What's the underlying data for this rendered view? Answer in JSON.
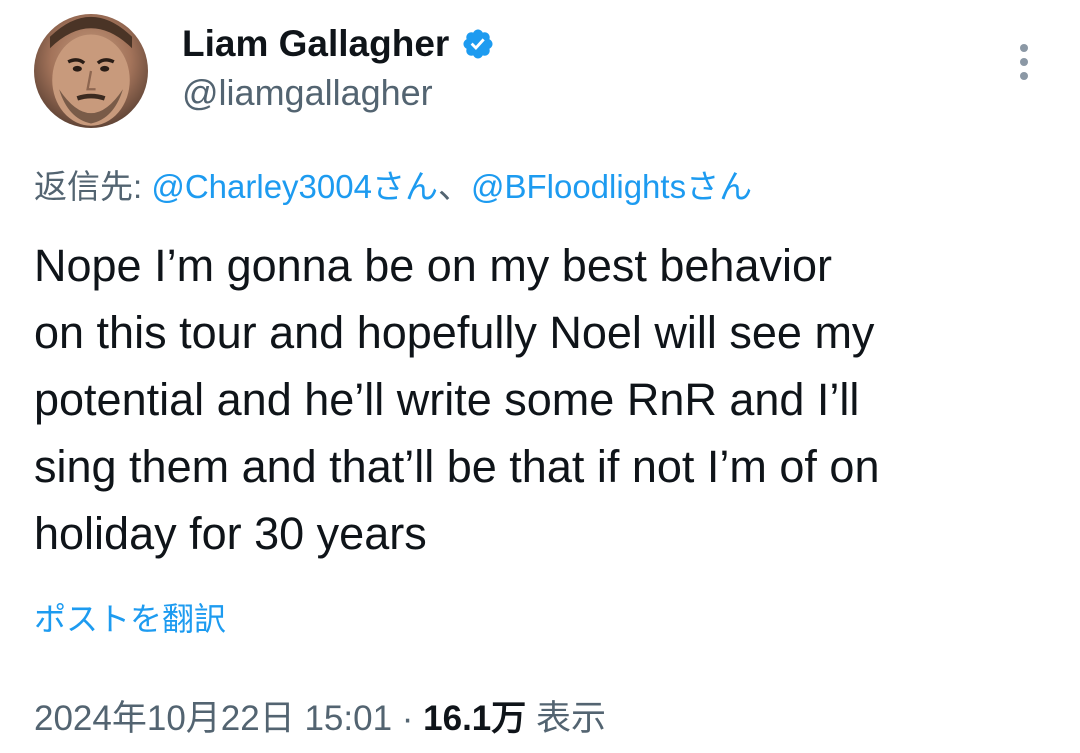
{
  "author": {
    "display_name": "Liam Gallagher",
    "handle": "@liamgallagher",
    "verified_icon": "verified-badge-icon"
  },
  "reply": {
    "prefix": "返信先: ",
    "mentions": [
      "@Charley3004さん",
      "@BFloodlightsさん"
    ],
    "separator": "、"
  },
  "tweet": {
    "text": "Nope I’m gonna be on my best behavior\non this tour and hopefully Noel will see my\npotential and he’ll write some RnR and I’ll\nsing them and that’ll be that if not I’m of on\nholiday for 30 years"
  },
  "translate": {
    "label": "ポストを翻訳"
  },
  "meta": {
    "timestamp": "2024年10月22日 15:01",
    "separator": " · ",
    "views_count": "16.1万",
    "views_label": " 表示"
  },
  "colors": {
    "accent": "#1d9bf0",
    "text": "#0f1419",
    "muted": "#536471"
  }
}
